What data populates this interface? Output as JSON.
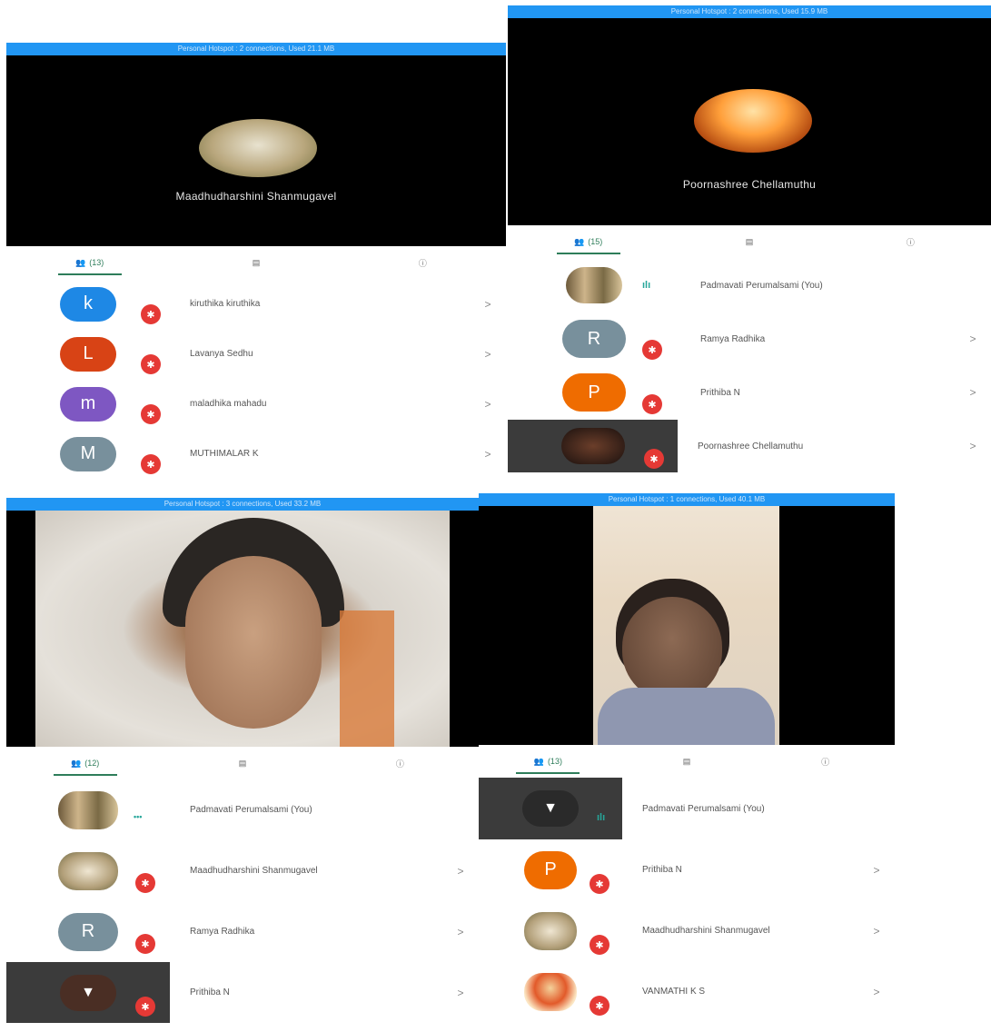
{
  "panels": {
    "tl": {
      "status": "Personal Hotspot : 2 connections, Used 21.1 MB",
      "speaker": "Maadhudharshini Shanmugavel",
      "count": "(13)",
      "rows": [
        {
          "letter": "k",
          "name": "kiruthika kiruthika",
          "color": "#1e88e5"
        },
        {
          "letter": "L",
          "name": "Lavanya Sedhu",
          "color": "#d84315"
        },
        {
          "letter": "m",
          "name": "maladhika mahadu",
          "color": "#7e57c2"
        },
        {
          "letter": "M",
          "name": "MUTHIMALAR K",
          "color": "#78909c"
        }
      ]
    },
    "tr": {
      "status": "Personal Hotspot : 2 connections, Used 15.9 MB",
      "speaker": "Poornashree Chellamuthu",
      "count": "(15)",
      "rows": [
        {
          "name": "Padmavati Perumalsami (You)"
        },
        {
          "letter": "R",
          "name": "Ramya Radhika",
          "color": "#78909c"
        },
        {
          "letter": "P",
          "name": "Prithiba N",
          "color": "#ef6c00"
        },
        {
          "name": "Poornashree Chellamuthu"
        }
      ]
    },
    "bl": {
      "status": "Personal Hotspot : 3 connections, Used 33.2 MB",
      "count": "(12)",
      "rows": [
        {
          "name": "Padmavati Perumalsami (You)"
        },
        {
          "name": "Maadhudharshini Shanmugavel"
        },
        {
          "letter": "R",
          "name": "Ramya Radhika",
          "color": "#78909c"
        },
        {
          "name": "Prithiba N"
        }
      ]
    },
    "br": {
      "status": "Personal Hotspot : 1 connections, Used 40.1 MB",
      "count": "(13)",
      "rows": [
        {
          "name": "Padmavati Perumalsami (You)"
        },
        {
          "letter": "P",
          "name": "Prithiba N",
          "color": "#ef6c00"
        },
        {
          "name": "Maadhudharshini Shanmugavel"
        },
        {
          "name": "VANMATHI K S"
        }
      ]
    }
  },
  "icons": {
    "people": "people-icon",
    "chat": "chat-icon",
    "info": "info-icon",
    "chevron": "chevron-right-icon",
    "mic_off": "mic-off-icon",
    "speaking": "speaking-indicator-icon",
    "hand": "raise-hand-icon"
  },
  "glyphs": {
    "chevron": ">",
    "mic_off": "✱",
    "hand": "▼",
    "dots": "•••",
    "wave": "ılı"
  }
}
